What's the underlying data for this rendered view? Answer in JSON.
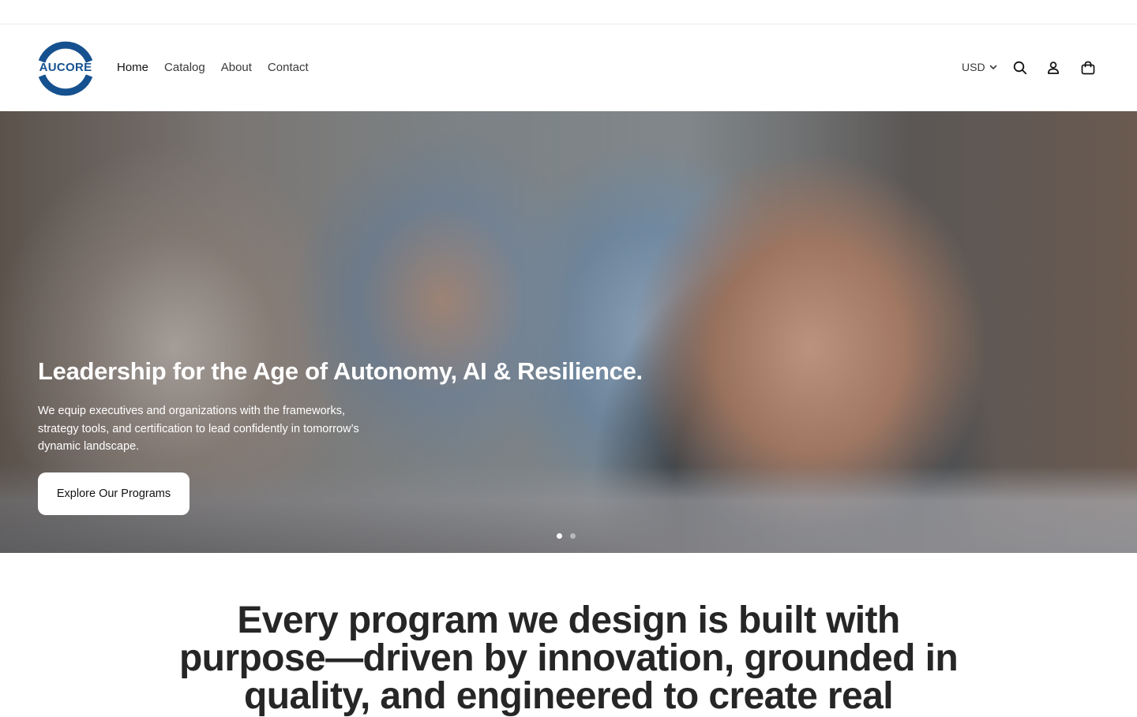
{
  "header": {
    "logo_text": "AUCORE",
    "nav": [
      {
        "label": "Home"
      },
      {
        "label": "Catalog"
      },
      {
        "label": "About"
      },
      {
        "label": "Contact"
      }
    ],
    "currency": "USD",
    "icons": [
      "search-icon",
      "account-icon",
      "cart-icon"
    ]
  },
  "hero": {
    "title": "Leadership for the Age of Autonomy, AI & Resilience.",
    "subtitle": "We equip executives and organizations with the frameworks, strategy tools, and certification to lead confidently in tomorrow’s dynamic landscape.",
    "button_label": "Explore Our Programs",
    "slide_count": 2,
    "active_slide": 1
  },
  "statement": {
    "text": "Every program we design is built with purpose—driven by innovation, grounded in quality, and engineered to create real"
  },
  "colors": {
    "brand_blue": "#16518f",
    "text": "#121212"
  }
}
